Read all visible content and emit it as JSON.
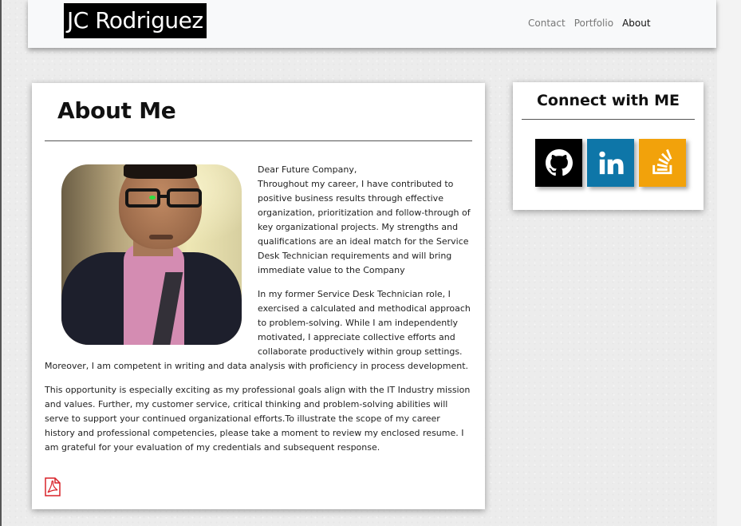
{
  "navbar": {
    "brand": "JC Rodriguez",
    "links": [
      {
        "label": "Contact",
        "active": false
      },
      {
        "label": "Portfolio",
        "active": false
      },
      {
        "label": "About",
        "active": true
      }
    ]
  },
  "about": {
    "title": "About Me",
    "portrait_alt": "portrait photo",
    "paragraphs": [
      "Dear Future Company,\nThroughout my career, I have contributed to positive business results through effective organization, prioritization and follow-through of key organizational projects. My strengths and qualifications are an ideal match for the Service Desk Technician requirements and will bring immediate value to the Company",
      "In my former Service Desk Technician role, I exercised a calculated and methodical approach to problem-solving. While I am independently motivated, I appreciate collective efforts and collaborate productively within group settings. Moreover, I am competent in writing and data analysis with proficiency in process development.",
      "This opportunity is especially exciting as my professional goals align with the IT Industry mission and values. Further, my customer service, critical thinking and problem-solving abilities will serve to support your continued organizational efforts.To illustrate the scope of my career history and professional competencies, please take a moment to review my enclosed resume. I am grateful for your evaluation of my credentials and subsequent response."
    ],
    "resume_icon": "pdf-file-icon"
  },
  "connect": {
    "title": "Connect with ME",
    "links": [
      {
        "icon": "github-icon",
        "color": "#000000"
      },
      {
        "icon": "linkedin-icon",
        "color": "#0e76a8"
      },
      {
        "icon": "stack-overflow-icon",
        "color": "#f2a20b"
      }
    ]
  }
}
